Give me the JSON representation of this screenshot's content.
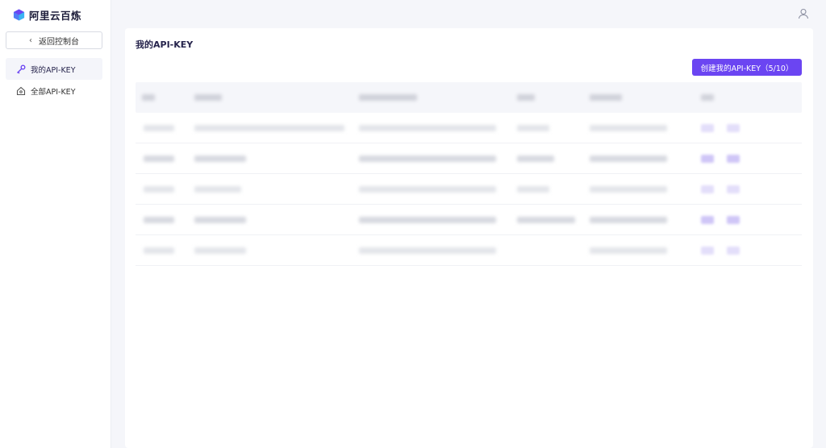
{
  "brand": {
    "name": "阿里云百炼",
    "logo_icon": "bailian-cube-logo",
    "accent": "#6b45f2"
  },
  "sidebar": {
    "back_label": "返回控制台",
    "items": [
      {
        "label": "我的API-KEY",
        "icon": "key-icon",
        "active": true
      },
      {
        "label": "全部API-KEY",
        "icon": "home-key-icon",
        "active": false
      }
    ]
  },
  "header": {
    "user_icon": "user-icon"
  },
  "main": {
    "title": "我的API-KEY",
    "create_button_label": "创建我的API-KEY（5/10）",
    "table": {
      "headers_obscured": true,
      "row_count": 5,
      "cell_text_obscured": true
    }
  }
}
